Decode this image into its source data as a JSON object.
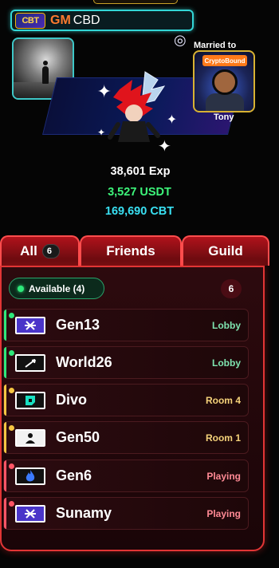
{
  "profile": {
    "logo_text": "CBT",
    "title_prefix": "GM",
    "name": "CBD",
    "married_label": "Married to",
    "partner_logo_text": "CryptoBound",
    "partner_name": "Tony"
  },
  "stats": {
    "exp": "38,601 Exp",
    "usdt": "3,527 USDT",
    "cbt": "169,690 CBT"
  },
  "tabs": [
    {
      "label": "All",
      "badge": "6"
    },
    {
      "label": "Friends"
    },
    {
      "label": "Guild"
    }
  ],
  "list": {
    "available_label": "Available (4)",
    "total_count": "6",
    "servers": [
      {
        "name": "Gen13",
        "status": "Lobby",
        "icon": "stellar-icon",
        "state": "available"
      },
      {
        "name": "World26",
        "status": "Lobby",
        "icon": "arrow-icon",
        "state": "available"
      },
      {
        "name": "Divo",
        "status": "Room 4",
        "icon": "block-icon",
        "state": "room"
      },
      {
        "name": "Gen50",
        "status": "Room 1",
        "icon": "person-icon",
        "state": "room"
      },
      {
        "name": "Gen6",
        "status": "Playing",
        "icon": "flame-icon",
        "state": "playing"
      },
      {
        "name": "Sunamy",
        "status": "Playing",
        "icon": "stellar-icon",
        "state": "playing"
      }
    ]
  },
  "colors": {
    "accent_red": "#e13535",
    "cyan": "#33d6d6",
    "usdt_green": "#3df57a",
    "cbt_cyan": "#39e0f2",
    "status_available": "#2ee87a",
    "status_room": "#f5c542",
    "status_playing": "#ff5566"
  }
}
